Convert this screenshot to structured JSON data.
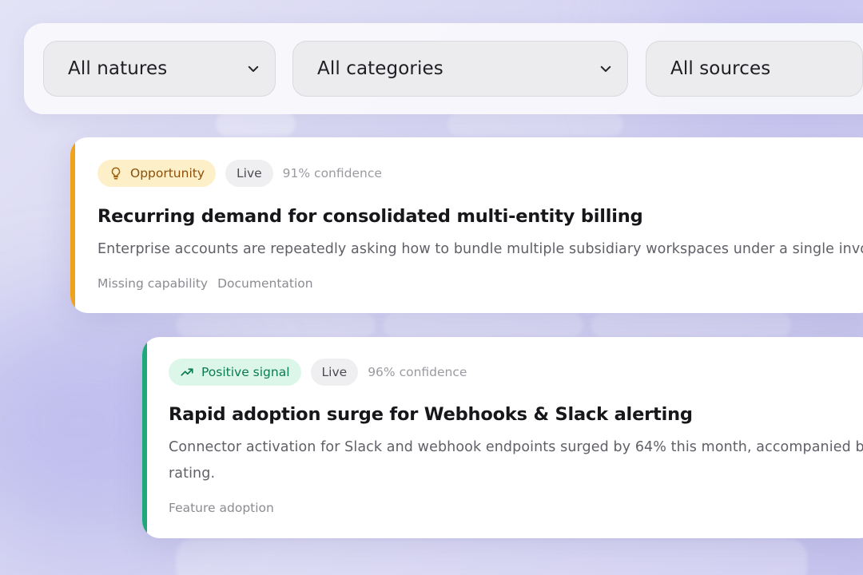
{
  "filters": [
    {
      "label": "All natures"
    },
    {
      "label": "All categories"
    },
    {
      "label": "All sources"
    }
  ],
  "cards": [
    {
      "type_label": "Opportunity",
      "type_icon": "lightbulb-icon",
      "status": "Live",
      "confidence": "91% confidence",
      "title": "Recurring demand for consolidated multi-entity billing",
      "description": "Enterprise accounts are repeatedly asking how to bundle multiple subsidiary workspaces under a single invoicing",
      "tags": [
        "Missing capability",
        "Documentation"
      ]
    },
    {
      "type_label": "Positive signal",
      "type_icon": "trending-up-icon",
      "status": "Live",
      "confidence": "96% confidence",
      "title": "Rapid adoption surge for Webhooks & Slack alerting",
      "description_line1": "Connector activation for Slack and webhook endpoints surged by 64% this month, accompanied by a",
      "description_line2": "rating.",
      "tags": [
        "Feature adoption"
      ]
    }
  ],
  "colors": {
    "opportunity_accent": "#efa21c",
    "opportunity_pill_bg": "#fdf0c8",
    "opportunity_pill_text": "#8a4f0b",
    "positive_accent": "#1fa97a",
    "positive_pill_bg": "#dcf6ea",
    "positive_pill_text": "#0d7a52"
  }
}
